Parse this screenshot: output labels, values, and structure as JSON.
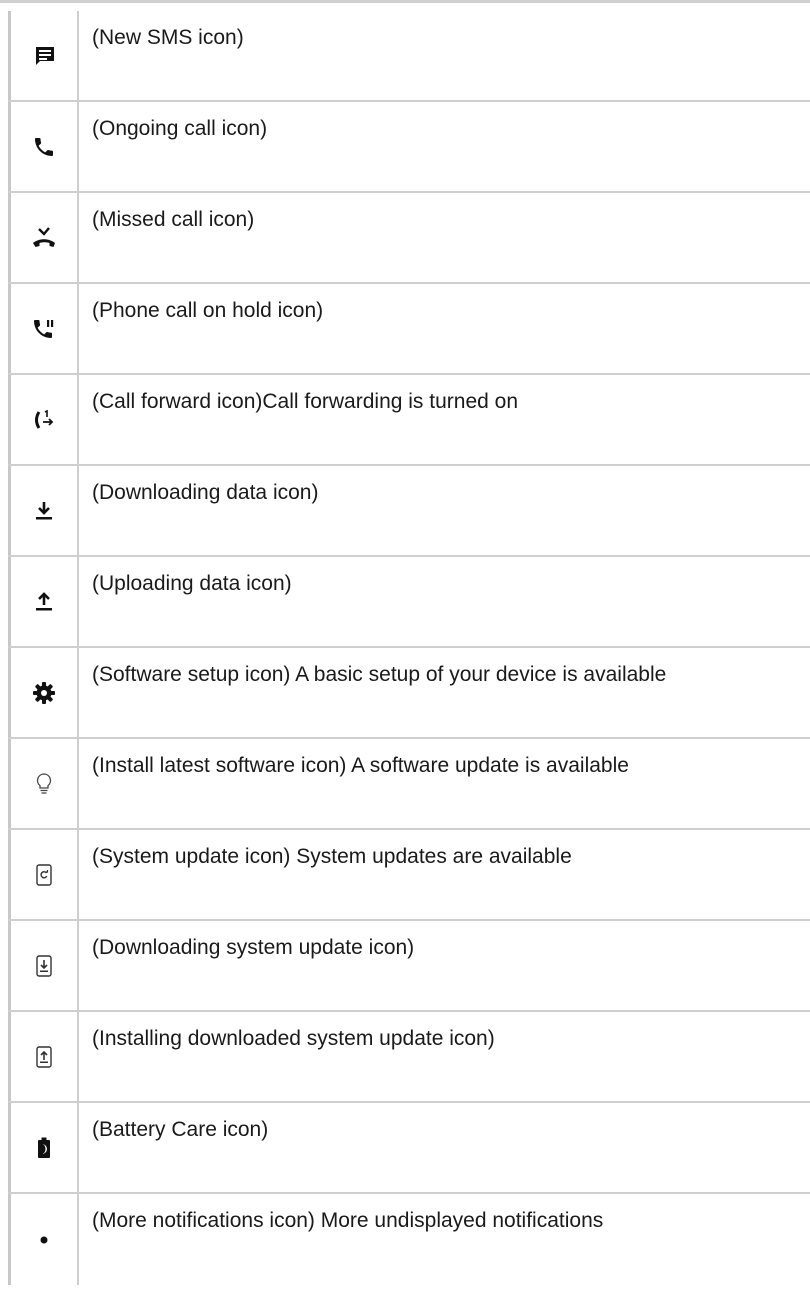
{
  "rows": [
    {
      "icon": "new-sms-icon",
      "text": "(New SMS icon)"
    },
    {
      "icon": "ongoing-call-icon",
      "text": "(Ongoing call icon)"
    },
    {
      "icon": "missed-call-icon",
      "text": "(Missed call icon)"
    },
    {
      "icon": "call-on-hold-icon",
      "text": "(Phone call on hold icon)"
    },
    {
      "icon": "call-forward-icon",
      "text": "(Call forward icon)Call forwarding is turned on"
    },
    {
      "icon": "download-icon",
      "text": "(Downloading data icon)"
    },
    {
      "icon": "upload-icon",
      "text": "(Uploading data icon)"
    },
    {
      "icon": "gear-icon",
      "text": "(Software setup icon) A basic setup of your device is available"
    },
    {
      "icon": "lightbulb-icon",
      "text": "(Install latest software icon) A software update is available"
    },
    {
      "icon": "system-update-icon",
      "text": "(System update icon) System updates are available"
    },
    {
      "icon": "downloading-system-update-icon",
      "text": "(Downloading system update icon)"
    },
    {
      "icon": "installing-system-update-icon",
      "text": "(Installing downloaded system update icon)"
    },
    {
      "icon": "battery-care-icon",
      "text": "(Battery Care icon)"
    },
    {
      "icon": "more-notifications-icon",
      "text": "(More notifications icon) More undisplayed notifications"
    }
  ]
}
